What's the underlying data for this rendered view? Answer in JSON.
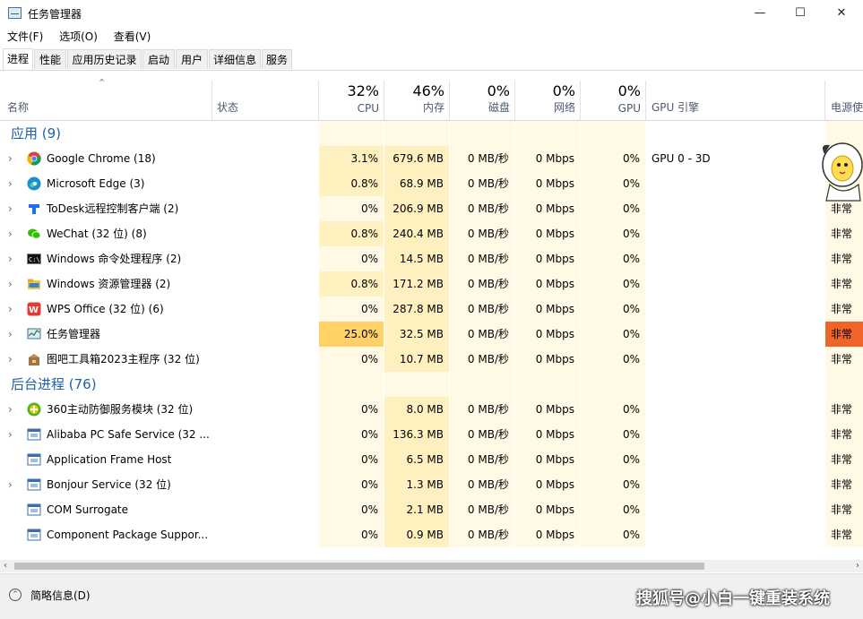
{
  "window": {
    "title": "任务管理器",
    "min": "—",
    "max": "☐",
    "close": "✕"
  },
  "menu": [
    "文件(F)",
    "选项(O)",
    "查看(V)"
  ],
  "tabs": [
    "进程",
    "性能",
    "应用历史记录",
    "启动",
    "用户",
    "详细信息",
    "服务"
  ],
  "active_tab": "进程",
  "columns": {
    "name": "名称",
    "status": "状态",
    "cpu": {
      "pct": "32%",
      "label": "CPU"
    },
    "mem": {
      "pct": "46%",
      "label": "内存"
    },
    "disk": {
      "pct": "0%",
      "label": "磁盘"
    },
    "net": {
      "pct": "0%",
      "label": "网络"
    },
    "gpu": {
      "pct": "0%",
      "label": "GPU"
    },
    "gpu_engine": "GPU 引擎",
    "power": "电源使"
  },
  "sections": [
    {
      "title": "应用 (9)",
      "rows": [
        {
          "name": "Google Chrome (18)",
          "icon": "chrome-icon",
          "cpu": "3.1%",
          "mem": "679.6 MB",
          "disk": "0 MB/秒",
          "net": "0 Mbps",
          "gpu": "0%",
          "engine": "GPU 0 - 3D",
          "power": ""
        },
        {
          "name": "Microsoft Edge (3)",
          "icon": "edge-icon",
          "cpu": "0.8%",
          "mem": "68.9 MB",
          "disk": "0 MB/秒",
          "net": "0 Mbps",
          "gpu": "0%",
          "engine": "",
          "power": ""
        },
        {
          "name": "ToDesk远程控制客户端 (2)",
          "icon": "todesk-icon",
          "cpu": "0%",
          "mem": "206.9 MB",
          "disk": "0 MB/秒",
          "net": "0 Mbps",
          "gpu": "0%",
          "engine": "",
          "power": "非常"
        },
        {
          "name": "WeChat (32 位) (8)",
          "icon": "wechat-icon",
          "cpu": "0.8%",
          "mem": "240.4 MB",
          "disk": "0 MB/秒",
          "net": "0 Mbps",
          "gpu": "0%",
          "engine": "",
          "power": "非常"
        },
        {
          "name": "Windows 命令处理程序 (2)",
          "icon": "cmd-icon",
          "cpu": "0%",
          "mem": "14.5 MB",
          "disk": "0 MB/秒",
          "net": "0 Mbps",
          "gpu": "0%",
          "engine": "",
          "power": "非常"
        },
        {
          "name": "Windows 资源管理器 (2)",
          "icon": "explorer-icon",
          "cpu": "0.8%",
          "mem": "171.2 MB",
          "disk": "0 MB/秒",
          "net": "0 Mbps",
          "gpu": "0%",
          "engine": "",
          "power": "非常"
        },
        {
          "name": "WPS Office (32 位) (6)",
          "icon": "wps-icon",
          "cpu": "0%",
          "mem": "287.8 MB",
          "disk": "0 MB/秒",
          "net": "0 Mbps",
          "gpu": "0%",
          "engine": "",
          "power": "非常"
        },
        {
          "name": "任务管理器",
          "icon": "taskmgr-icon",
          "cpu": "25.0%",
          "mem": "32.5 MB",
          "disk": "0 MB/秒",
          "net": "0 Mbps",
          "gpu": "0%",
          "engine": "",
          "power": "非常",
          "hot": true
        },
        {
          "name": "图吧工具箱2023主程序 (32 位)",
          "icon": "tuba-icon",
          "cpu": "0%",
          "mem": "10.7 MB",
          "disk": "0 MB/秒",
          "net": "0 Mbps",
          "gpu": "0%",
          "engine": "",
          "power": "非常"
        }
      ]
    },
    {
      "title": "后台进程 (76)",
      "rows": [
        {
          "name": "360主动防御服务模块 (32 位)",
          "icon": "360-icon",
          "cpu": "0%",
          "mem": "8.0 MB",
          "disk": "0 MB/秒",
          "net": "0 Mbps",
          "gpu": "0%",
          "engine": "",
          "power": "非常",
          "expand": true
        },
        {
          "name": "Alibaba PC Safe Service (32 ...",
          "icon": "service-icon",
          "cpu": "0%",
          "mem": "136.3 MB",
          "disk": "0 MB/秒",
          "net": "0 Mbps",
          "gpu": "0%",
          "engine": "",
          "power": "非常",
          "expand": true
        },
        {
          "name": "Application Frame Host",
          "icon": "service-icon",
          "cpu": "0%",
          "mem": "6.5 MB",
          "disk": "0 MB/秒",
          "net": "0 Mbps",
          "gpu": "0%",
          "engine": "",
          "power": "非常",
          "expand": false
        },
        {
          "name": "Bonjour Service (32 位)",
          "icon": "service-icon",
          "cpu": "0%",
          "mem": "1.3 MB",
          "disk": "0 MB/秒",
          "net": "0 Mbps",
          "gpu": "0%",
          "engine": "",
          "power": "非常",
          "expand": true
        },
        {
          "name": "COM Surrogate",
          "icon": "service-icon",
          "cpu": "0%",
          "mem": "2.1 MB",
          "disk": "0 MB/秒",
          "net": "0 Mbps",
          "gpu": "0%",
          "engine": "",
          "power": "非常",
          "expand": false
        },
        {
          "name": "Component Package Suppor...",
          "icon": "service-icon",
          "cpu": "0%",
          "mem": "0.9 MB",
          "disk": "0 MB/秒",
          "net": "0 Mbps",
          "gpu": "0%",
          "engine": "",
          "power": "非常",
          "expand": false
        }
      ]
    }
  ],
  "footer": {
    "label": "简略信息(D)"
  },
  "watermark": "搜狐号@小白一键重装系统",
  "colors": {
    "heat_light": "#fff9e5",
    "heat_mid": "#fff0c0",
    "heat_cpu_hot": "#ffd166",
    "power_hot": "#f0642a",
    "section": "#1f5fa8"
  }
}
